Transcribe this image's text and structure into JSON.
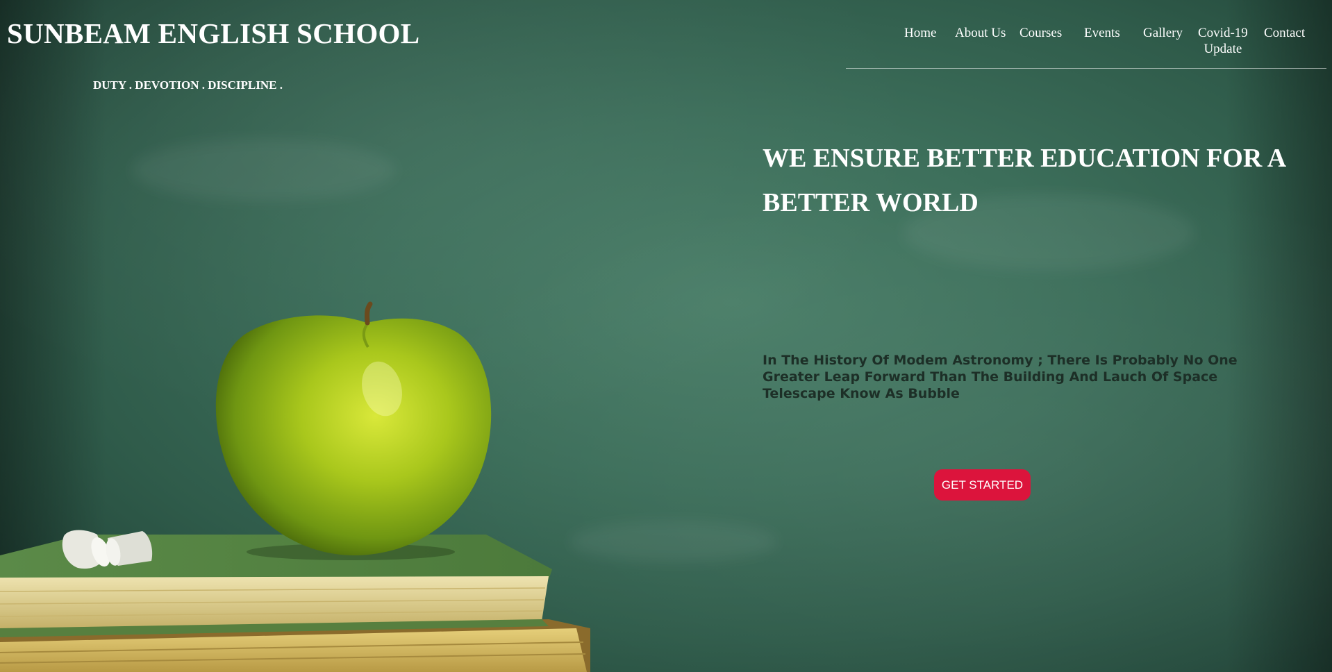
{
  "header": {
    "site_title": "SUNBEAM ENGLISH SCHOOL",
    "tagline": "DUTY . DEVOTION . DISCIPLINE ."
  },
  "nav": {
    "items": [
      {
        "label": "Home"
      },
      {
        "label": "About Us"
      },
      {
        "label": "Courses"
      },
      {
        "label": "Events"
      },
      {
        "label": "Gallery"
      },
      {
        "label": "Covid-19\nUpdate"
      },
      {
        "label": "Contact"
      }
    ]
  },
  "hero": {
    "heading": "WE ENSURE BETTER EDUCATION FOR A BETTER WORLD",
    "text": "In The History Of Modem Astronomy ; There Is Probably No One Greater Leap Forward Than The Building And Lauch Of Space Telescape Know As Bubble",
    "button_label": "GET STARTED"
  },
  "colors": {
    "chalkboard": "#3c6e5a",
    "button": "#dc143c",
    "hero_text": "#1d2f27",
    "apple": "#a8c81a"
  },
  "illustration": {
    "subject": "apple-on-books",
    "icon": "apple-icon"
  }
}
